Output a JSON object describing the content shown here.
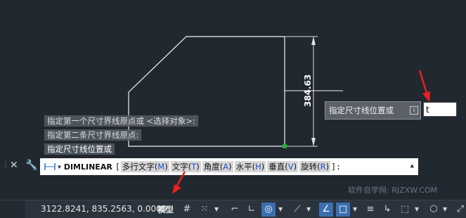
{
  "history": [
    "指定第一个尺寸界线原点或 <选择对象>:",
    "指定第二条尺寸界线原点:",
    "指定尺寸线位置或"
  ],
  "dimension_text": "384.63",
  "tooltip": {
    "label": "指定尺寸线位置或",
    "icon": "arrow-down-icon"
  },
  "dynamic_input": {
    "value": "t"
  },
  "command": {
    "name": "DIMLINEAR",
    "open_bracket": "[",
    "options": [
      {
        "label": "多行文字",
        "key": "M"
      },
      {
        "label": "文字",
        "key": "T"
      },
      {
        "label": "角度",
        "key": "A"
      },
      {
        "label": "水平",
        "key": "H"
      },
      {
        "label": "垂直",
        "key": "V"
      },
      {
        "label": "旋转",
        "key": "R"
      }
    ],
    "close": "]:"
  },
  "watermark": "软件自学网: RJZXW.COM",
  "status": {
    "coordinates": "3122.8241, 835.2563, 0.0000",
    "space": "模型"
  },
  "colors": {
    "background": "#212830",
    "geometry": "#ffffff",
    "annotation_arrow": "#e8211f",
    "active_toggle": "#3a6fb0"
  }
}
